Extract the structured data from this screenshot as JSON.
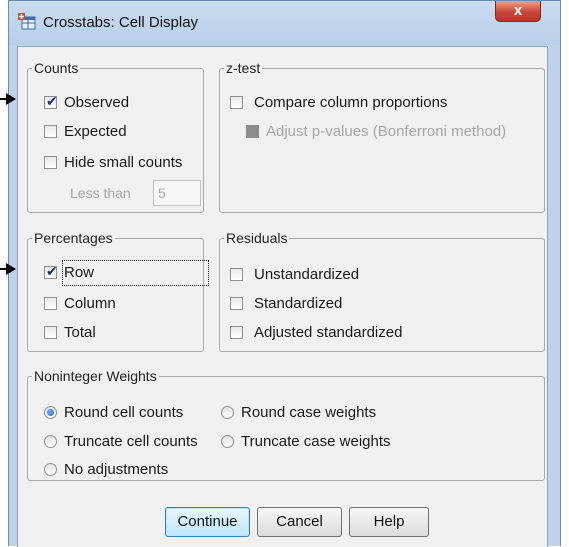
{
  "window": {
    "title": "Crosstabs: Cell Display",
    "close_label": "x"
  },
  "counts": {
    "legend": "Counts",
    "observed": {
      "label": "Observed",
      "checked": true
    },
    "expected": {
      "label": "Expected",
      "checked": false
    },
    "hide_small": {
      "label": "Hide small counts",
      "checked": false
    },
    "less_than_label": "Less than",
    "less_than_value": "5"
  },
  "ztest": {
    "legend": "z-test",
    "compare": {
      "label": "Compare column proportions",
      "checked": false
    },
    "adjust": {
      "label": "Adjust p-values (Bonferroni method)",
      "enabled": false
    }
  },
  "percentages": {
    "legend": "Percentages",
    "row": {
      "label": "Row",
      "checked": true
    },
    "column": {
      "label": "Column",
      "checked": false
    },
    "total": {
      "label": "Total",
      "checked": false
    }
  },
  "residuals": {
    "legend": "Residuals",
    "unstandardized": {
      "label": "Unstandardized",
      "checked": false
    },
    "standardized": {
      "label": "Standardized",
      "checked": false
    },
    "adjusted": {
      "label": "Adjusted standardized",
      "checked": false
    }
  },
  "weights": {
    "legend": "Noninteger Weights",
    "round_cell": {
      "label": "Round cell counts",
      "selected": true
    },
    "round_case": {
      "label": "Round case weights",
      "selected": false
    },
    "truncate_cell": {
      "label": "Truncate cell counts",
      "selected": false
    },
    "truncate_case": {
      "label": "Truncate case weights",
      "selected": false
    },
    "no_adjust": {
      "label": "No adjustments",
      "selected": false
    }
  },
  "buttons": {
    "continue": "Continue",
    "cancel": "Cancel",
    "help": "Help"
  },
  "colors": {
    "title_bar": "#bcd3ea",
    "dialog_bg": "#f0f0f0",
    "close_red": "#c8473a",
    "default_button": "#bee6fd"
  }
}
